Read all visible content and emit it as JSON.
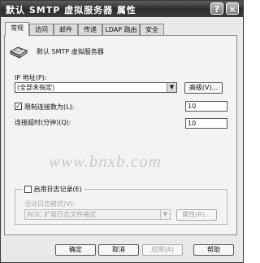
{
  "window": {
    "title": "默认 SMTP 虚拟服务器 属性",
    "help_glyph": "?",
    "close_glyph": "×"
  },
  "tabs": [
    "常规",
    "访问",
    "邮件",
    "传递",
    "LDAP 路由",
    "安全"
  ],
  "general": {
    "server_name": "默认 SMTP 虚拟服务器",
    "ip_label": "IP 地址(P):",
    "ip_value": "(全部未指定)",
    "advanced_button": "高级(V)...",
    "limit_connections_label": "限制连接数为(L):",
    "limit_connections_checked": true,
    "limit_connections_value": "10",
    "timeout_label": "连接超时(分钟)(Q):",
    "timeout_value": "10",
    "logging_label": "启用日志记录(E)",
    "logging_checked": false,
    "log_format_label": "活动日志格式(V):",
    "log_format_value": "W3C 扩展日志文件格式",
    "properties_button": "属性(R)..."
  },
  "watermark": "www.bnxb.com",
  "buttons": {
    "ok": "确定",
    "cancel": "取消",
    "apply": "应用(A)",
    "help": "帮助"
  },
  "icons": {
    "server": "server-icon",
    "dropdown": "chevron-down-icon",
    "check": "checkmark-icon"
  },
  "colors": {
    "titlebar": "#3b3b3b",
    "dialog_bg": "#e9e9e9",
    "panel_bg": "#f3f3f3"
  }
}
